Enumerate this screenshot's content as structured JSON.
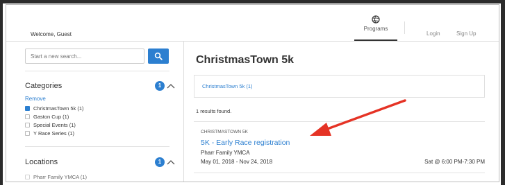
{
  "header": {
    "welcome": "Welcome, Guest",
    "nav": {
      "programs_label": "Programs",
      "programs_icon": "globe-icon",
      "login_label": "Login",
      "signup_label": "Sign Up"
    }
  },
  "sidebar": {
    "search": {
      "placeholder": "Start a new search...",
      "button_icon": "search-icon"
    },
    "categories": {
      "title": "Categories",
      "badge": "1",
      "remove_label": "Remove",
      "items": [
        {
          "label": "ChristmasTown 5k (1)",
          "checked": true
        },
        {
          "label": "Gaston Cup (1)",
          "checked": false
        },
        {
          "label": "Special Events (1)",
          "checked": false
        },
        {
          "label": "Y Race Series (1)",
          "checked": false
        }
      ]
    },
    "locations": {
      "title": "Locations",
      "badge": "1",
      "items": [
        {
          "label": "Pharr Family YMCA (1)",
          "checked": true
        }
      ]
    }
  },
  "main": {
    "title": "ChristmasTown 5k",
    "filter_link": "ChristmasTown 5k (1)",
    "results_count": "1 results found.",
    "result": {
      "category": "CHRISTMASTOWN 5K",
      "title": "5K - Early Race registration",
      "organization": "Pharr Family YMCA",
      "dates": "May 01, 2018 - Nov 24, 2018",
      "time": "Sat @ 6:00 PM-7:30 PM"
    }
  },
  "colors": {
    "accent": "#2c7fd0",
    "annotation_arrow": "#e53325"
  }
}
